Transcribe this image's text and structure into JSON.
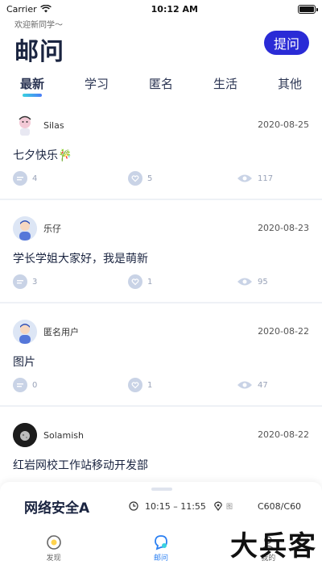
{
  "status": {
    "carrier": "Carrier",
    "time": "10:12 AM"
  },
  "header": {
    "welcome": "欢迎新同学～",
    "title": "邮问",
    "ask_label": "提问"
  },
  "tabs": [
    {
      "label": "最新",
      "active": true
    },
    {
      "label": "学习"
    },
    {
      "label": "匿名"
    },
    {
      "label": "生活"
    },
    {
      "label": "其他"
    }
  ],
  "posts": [
    {
      "user": "Silas",
      "date": "2020-08-25",
      "content": "七夕快乐🎋",
      "comments": "4",
      "likes": "5",
      "views": "117",
      "avatar": "cartoon"
    },
    {
      "user": "乐仔",
      "date": "2020-08-23",
      "content": "学长学姐大家好，我是萌新",
      "comments": "3",
      "likes": "1",
      "views": "95",
      "avatar": "default"
    },
    {
      "user": "匿名用户",
      "date": "2020-08-22",
      "content": "图片",
      "comments": "0",
      "likes": "1",
      "views": "47",
      "avatar": "default"
    },
    {
      "user": "Solamish",
      "date": "2020-08-22",
      "content": "红岩网校工作站移动开发部",
      "avatar": "dark"
    }
  ],
  "course": {
    "name": "网络安全A",
    "time": "10:15 – 11:55",
    "location": "图",
    "room": "C608/C60"
  },
  "nav": [
    {
      "label": "发现",
      "icon": "discover-icon"
    },
    {
      "label": "邮问",
      "icon": "mail-question-icon",
      "active": true
    },
    {
      "label": "我的",
      "icon": "profile-icon"
    }
  ],
  "watermark": "大兵客",
  "colors": {
    "accent": "#2a2bd6",
    "active_nav": "#2a7ff2",
    "stat_icon": "#c9d3e6"
  }
}
